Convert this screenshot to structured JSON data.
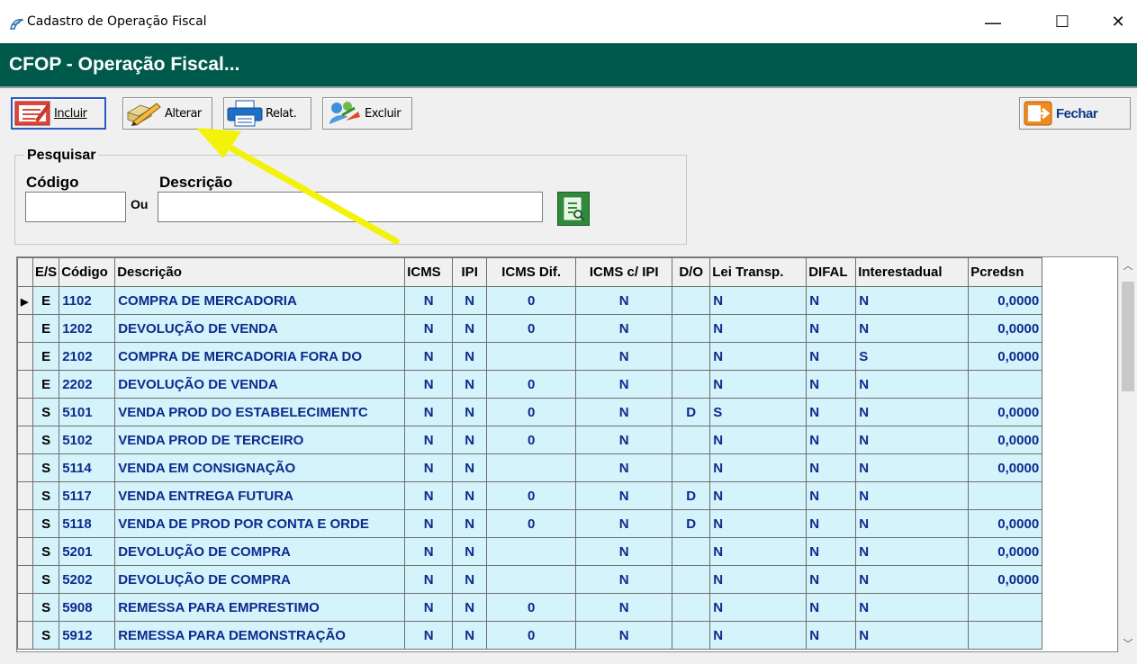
{
  "window": {
    "title": "Cadastro de Operação Fiscal",
    "minimize": "—",
    "maximize": "☐",
    "close": "✕"
  },
  "header": {
    "title": "CFOP - Operação Fiscal..."
  },
  "toolbar": {
    "incluir": "Incluir",
    "alterar": "Alterar",
    "relat": "Relat.",
    "excluir": "Excluir",
    "fechar": "Fechar"
  },
  "search": {
    "legend": "Pesquisar",
    "codigo_label": "Código",
    "descricao_label": "Descrição",
    "ou_label": "Ou",
    "codigo_value": "",
    "descricao_value": ""
  },
  "grid": {
    "columns": [
      "E/S",
      "Código",
      "Descrição",
      "ICMS",
      "IPI",
      "ICMS Dif.",
      "ICMS c/ IPI",
      "D/O",
      "Lei Transp.",
      "DIFAL",
      "Interestadual",
      "Pcredsn"
    ],
    "rows": [
      {
        "es": "E",
        "codigo": "1102",
        "descricao": "COMPRA DE MERCADORIA",
        "icms": "N",
        "ipi": "N",
        "icms_dif": "0",
        "icms_ipi": "N",
        "do": "",
        "lei": "N",
        "difal": "N",
        "inter": "N",
        "pcred": "0,0000"
      },
      {
        "es": "E",
        "codigo": "1202",
        "descricao": "DEVOLUÇÃO DE VENDA",
        "icms": "N",
        "ipi": "N",
        "icms_dif": "0",
        "icms_ipi": "N",
        "do": "",
        "lei": "N",
        "difal": "N",
        "inter": "N",
        "pcred": "0,0000"
      },
      {
        "es": "E",
        "codigo": "2102",
        "descricao": "COMPRA DE MERCADORIA FORA DO",
        "icms": "N",
        "ipi": "N",
        "icms_dif": "",
        "icms_ipi": "N",
        "do": "",
        "lei": "N",
        "difal": "N",
        "inter": "S",
        "pcred": "0,0000"
      },
      {
        "es": "E",
        "codigo": "2202",
        "descricao": "DEVOLUÇÃO DE VENDA",
        "icms": "N",
        "ipi": "N",
        "icms_dif": "0",
        "icms_ipi": "N",
        "do": "",
        "lei": "N",
        "difal": "N",
        "inter": "N",
        "pcred": ""
      },
      {
        "es": "S",
        "codigo": "5101",
        "descricao": "VENDA PROD DO ESTABELECIMENTC",
        "icms": "N",
        "ipi": "N",
        "icms_dif": "0",
        "icms_ipi": "N",
        "do": "D",
        "lei": "S",
        "difal": "N",
        "inter": "N",
        "pcred": "0,0000"
      },
      {
        "es": "S",
        "codigo": "5102",
        "descricao": "VENDA PROD DE TERCEIRO",
        "icms": "N",
        "ipi": "N",
        "icms_dif": "0",
        "icms_ipi": "N",
        "do": "",
        "lei": "N",
        "difal": "N",
        "inter": "N",
        "pcred": "0,0000"
      },
      {
        "es": "S",
        "codigo": "5114",
        "descricao": "VENDA EM CONSIGNAÇÃO",
        "icms": "N",
        "ipi": "N",
        "icms_dif": "",
        "icms_ipi": "N",
        "do": "",
        "lei": "N",
        "difal": "N",
        "inter": "N",
        "pcred": "0,0000"
      },
      {
        "es": "S",
        "codigo": "5117",
        "descricao": "VENDA ENTREGA FUTURA",
        "icms": "N",
        "ipi": "N",
        "icms_dif": "0",
        "icms_ipi": "N",
        "do": "D",
        "lei": "N",
        "difal": "N",
        "inter": "N",
        "pcred": ""
      },
      {
        "es": "S",
        "codigo": "5118",
        "descricao": "VENDA DE PROD POR CONTA E ORDE",
        "icms": "N",
        "ipi": "N",
        "icms_dif": "0",
        "icms_ipi": "N",
        "do": "D",
        "lei": "N",
        "difal": "N",
        "inter": "N",
        "pcred": "0,0000"
      },
      {
        "es": "S",
        "codigo": "5201",
        "descricao": "DEVOLUÇÃO DE COMPRA",
        "icms": "N",
        "ipi": "N",
        "icms_dif": "",
        "icms_ipi": "N",
        "do": "",
        "lei": "N",
        "difal": "N",
        "inter": "N",
        "pcred": "0,0000"
      },
      {
        "es": "S",
        "codigo": "5202",
        "descricao": "DEVOLUÇÃO DE COMPRA",
        "icms": "N",
        "ipi": "N",
        "icms_dif": "",
        "icms_ipi": "N",
        "do": "",
        "lei": "N",
        "difal": "N",
        "inter": "N",
        "pcred": "0,0000"
      },
      {
        "es": "S",
        "codigo": "5908",
        "descricao": "REMESSA PARA EMPRESTIMO",
        "icms": "N",
        "ipi": "N",
        "icms_dif": "0",
        "icms_ipi": "N",
        "do": "",
        "lei": "N",
        "difal": "N",
        "inter": "N",
        "pcred": ""
      },
      {
        "es": "S",
        "codigo": "5912",
        "descricao": "REMESSA PARA DEMONSTRAÇÃO",
        "icms": "N",
        "ipi": "N",
        "icms_dif": "0",
        "icms_ipi": "N",
        "do": "",
        "lei": "N",
        "difal": "N",
        "inter": "N",
        "pcred": ""
      }
    ]
  },
  "colors": {
    "header_bg": "#005a4c",
    "grid_row_bg": "#d4f3fb",
    "grid_text": "#0d2a8c",
    "annotation_arrow": "#f2f20a"
  }
}
